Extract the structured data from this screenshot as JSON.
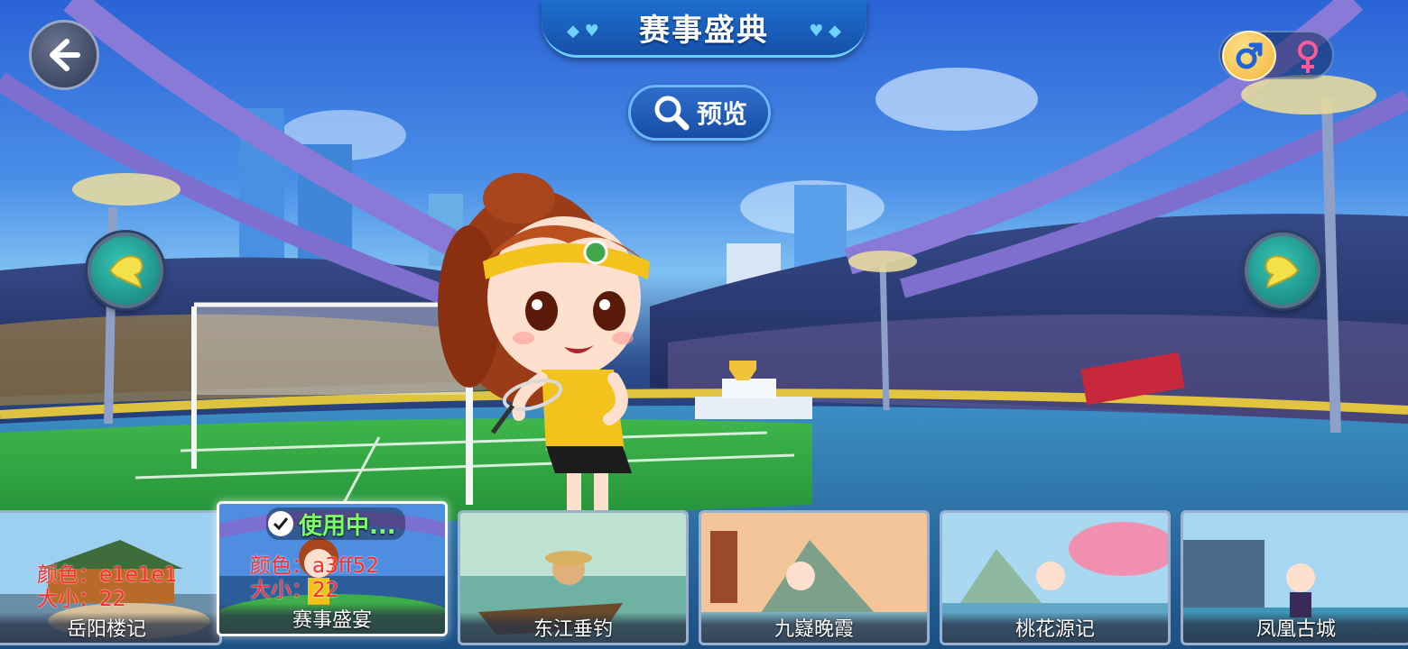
{
  "header": {
    "title": "赛事盛典"
  },
  "preview": {
    "label": "预览"
  },
  "gender": {
    "male_symbol": "♂",
    "female_symbol": "♀",
    "selected": "male"
  },
  "colors": {
    "accent": "#1e6fd0",
    "in_use": "#7aff66",
    "debug_text": "#ff2a2a",
    "arrow": "#37c7b4"
  },
  "scenes": [
    {
      "name": "岳阳楼记",
      "debug_color": "颜色：e1e1e1",
      "debug_size": "大小：22",
      "in_use": false
    },
    {
      "name": "赛事盛宴",
      "debug_color": "颜色：a3ff52",
      "debug_size": "大小：22",
      "in_use": true,
      "in_use_label": "使用中..."
    },
    {
      "name": "东江垂钓",
      "in_use": false
    },
    {
      "name": "九嶷晚霞",
      "in_use": false
    },
    {
      "name": "桃花源记",
      "in_use": false
    },
    {
      "name": "凤凰古城",
      "in_use": false
    }
  ],
  "icons": {
    "back": "back-arrow-icon",
    "search": "search-icon",
    "left": "spade-left-arrow-icon",
    "right": "spade-right-arrow-icon"
  }
}
